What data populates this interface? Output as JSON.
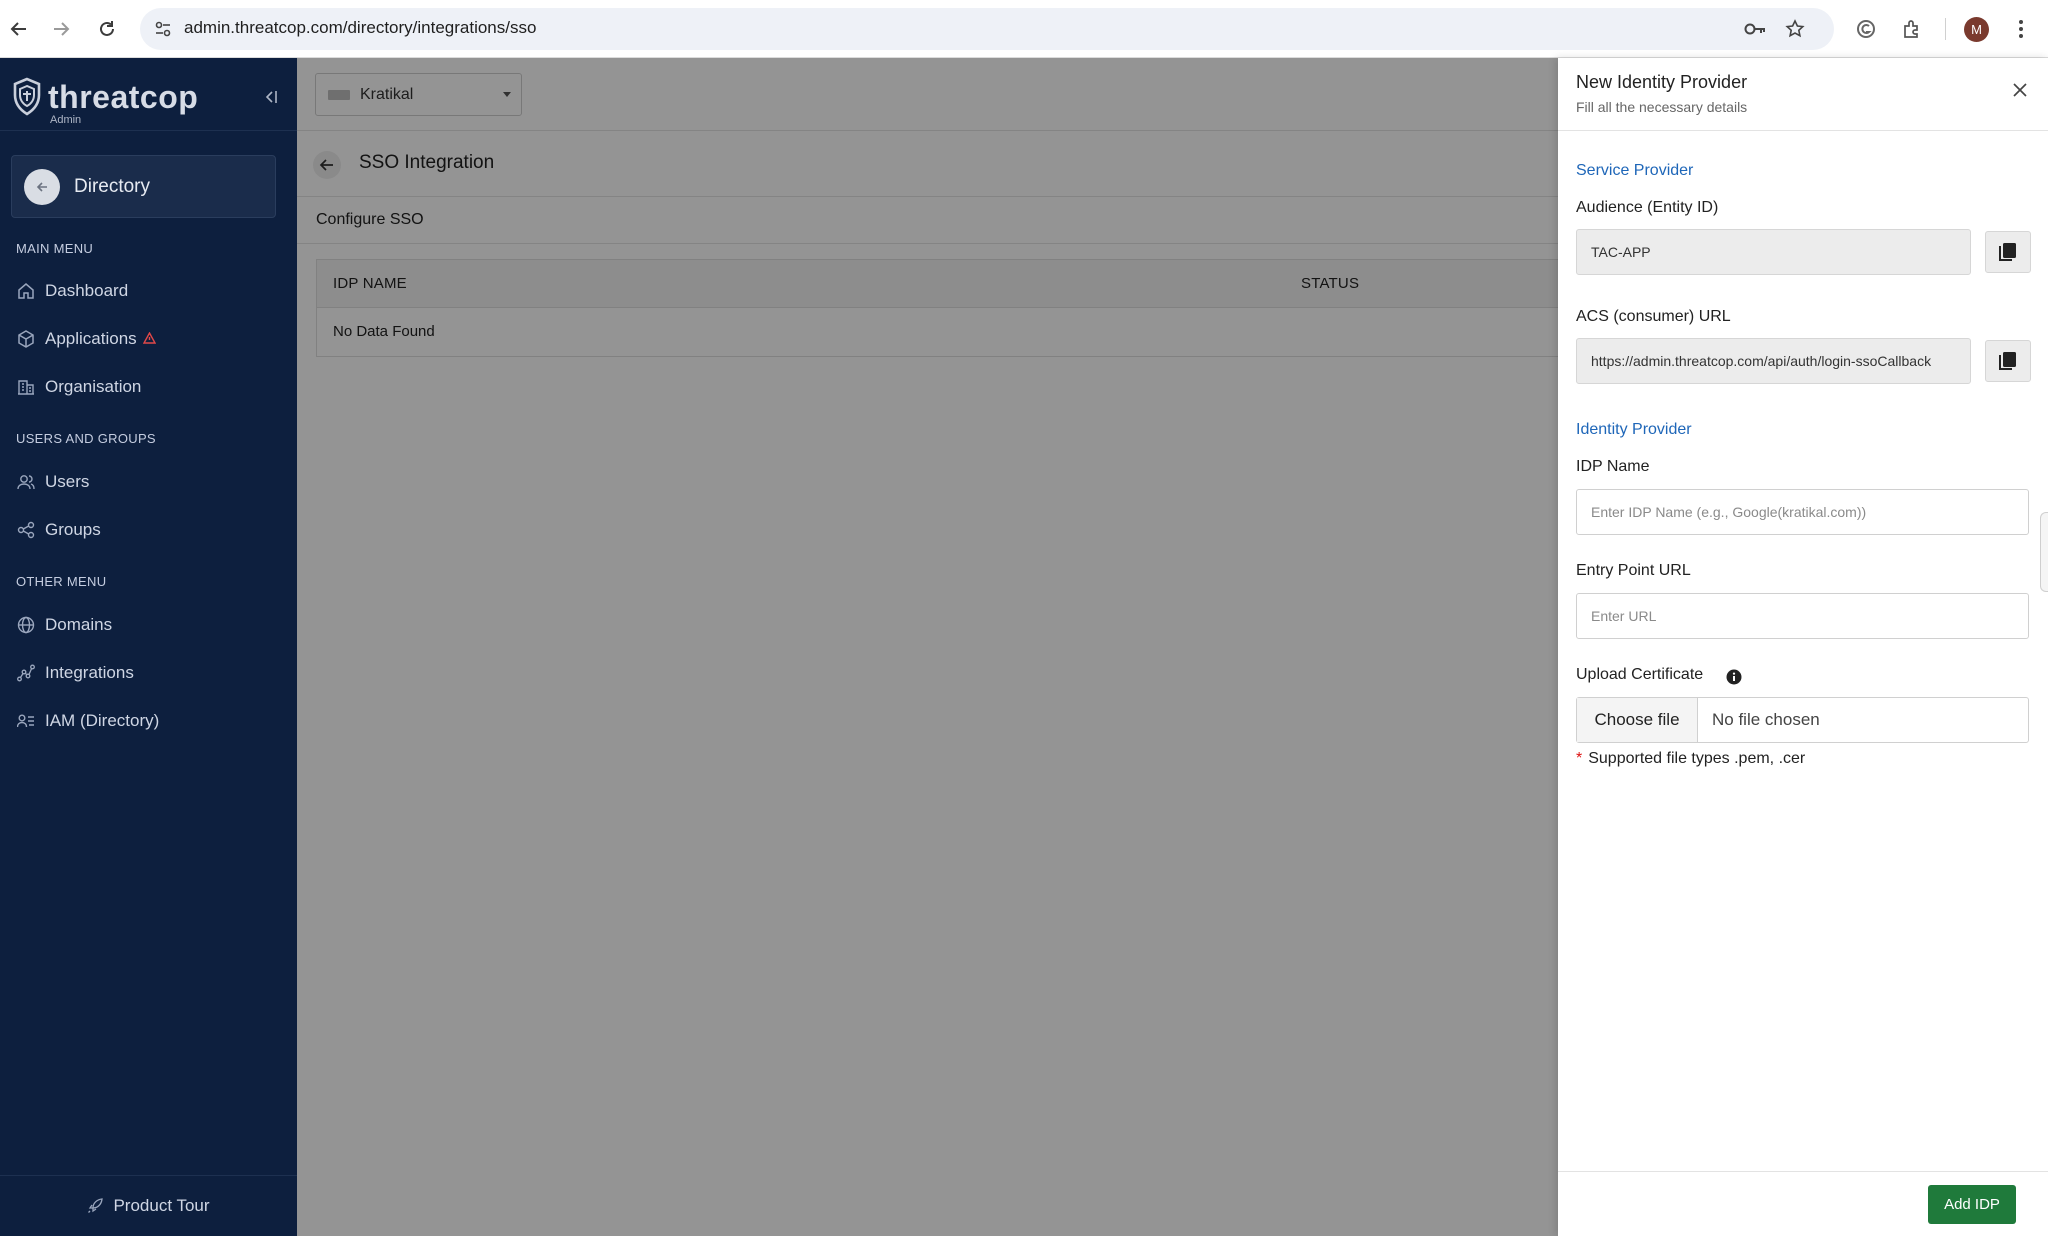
{
  "browser": {
    "url": "admin.threatcop.com/directory/integrations/sso",
    "profile_initial": "M"
  },
  "sidebar": {
    "brand_name": "threatcop",
    "brand_sub": "Admin",
    "directory_label": "Directory",
    "sections": [
      {
        "title": "MAIN MENU",
        "items": [
          "Dashboard",
          "Applications",
          "Organisation"
        ]
      },
      {
        "title": "USERS AND GROUPS",
        "items": [
          "Users",
          "Groups"
        ]
      },
      {
        "title": "OTHER MENU",
        "items": [
          "Domains",
          "Integrations",
          "IAM (Directory)"
        ]
      }
    ],
    "product_tour": "Product Tour"
  },
  "main": {
    "org_name": "Kratikal",
    "page_title": "SSO Integration",
    "sub_title": "Configure SSO",
    "table": {
      "columns": [
        "IDP NAME",
        "STATUS"
      ],
      "empty_text": "No Data Found"
    }
  },
  "drawer": {
    "title": "New Identity Provider",
    "subtitle": "Fill all the necessary details",
    "service_provider": {
      "section": "Service Provider",
      "audience_label": "Audience (Entity ID)",
      "audience_value": "TAC-APP",
      "acs_label": "ACS (consumer) URL",
      "acs_value": "https://admin.threatcop.com/api/auth/login-ssoCallback"
    },
    "identity_provider": {
      "section": "Identity Provider",
      "idp_name_label": "IDP Name",
      "idp_name_placeholder": "Enter IDP Name (e.g., Google(kratikal.com))",
      "entry_label": "Entry Point URL",
      "entry_placeholder": "Enter URL",
      "cert_label": "Upload Certificate",
      "choose_file": "Choose file",
      "no_file": "No file chosen",
      "hint": "Supported file types .pem, .cer"
    },
    "submit": "Add IDP"
  },
  "colors": {
    "sidebar_bg": "#0d1f3e",
    "accent_link": "#1e66b8",
    "primary_button": "#1f7a3b"
  }
}
